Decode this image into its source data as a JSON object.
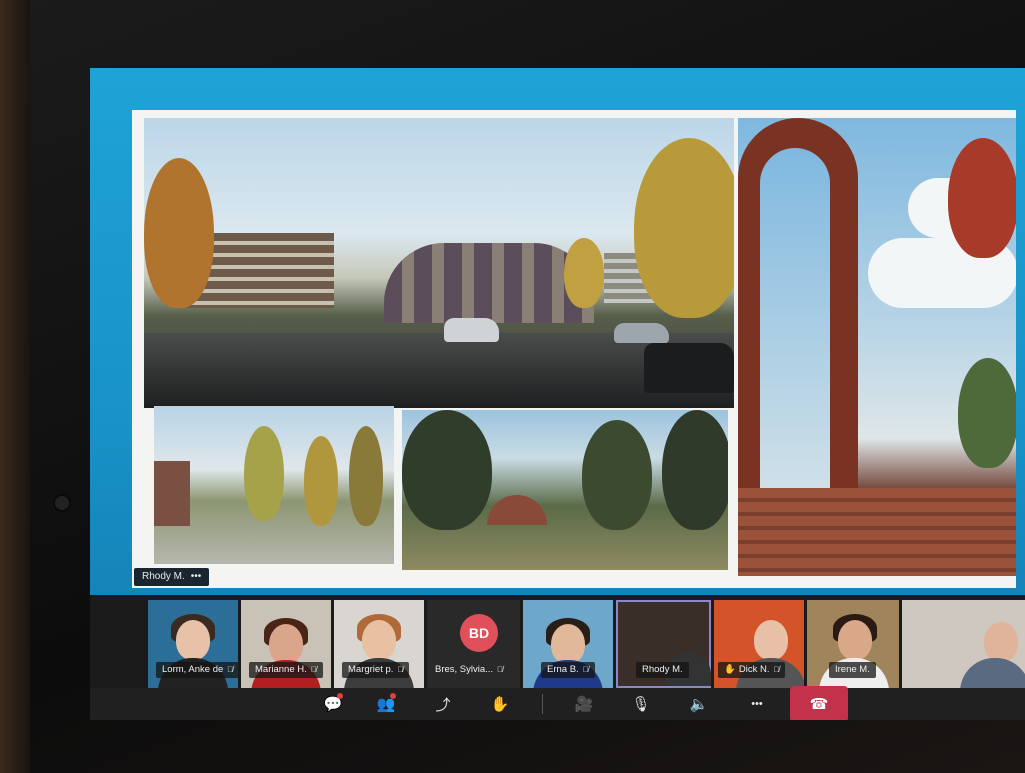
{
  "presenter": {
    "name": "Rhody M.",
    "more": "•••"
  },
  "participants": [
    {
      "name": "Lorm, Anke de",
      "muted": true,
      "bg": "#2b6f98",
      "skin": "#e8c2a8",
      "hair": "#3a2a20",
      "shirt": "#222"
    },
    {
      "name": "Marianne H.",
      "muted": true,
      "bg": "#c9c2b7",
      "skin": "#d9a68c",
      "hair": "#4a2416",
      "shirt": "#b02020"
    },
    {
      "name": "Margriet p.",
      "muted": true,
      "bg": "#d9d6d2",
      "skin": "#e8c0a2",
      "hair": "#b06a3a",
      "shirt": "#3c3c3c"
    },
    {
      "name": "Bres, Sylvia...",
      "muted": true,
      "avatar": "BD"
    },
    {
      "name": "Erna B.",
      "muted": true,
      "bg": "#6da7c9",
      "skin": "#e2b89a",
      "hair": "#2a1e18",
      "shirt": "#1e3a8a"
    },
    {
      "name": "Rhody M.",
      "muted": false,
      "bg": "#3a2e28",
      "skin": "#d8b09a",
      "hair": "#2a2a2a",
      "shirt": "#333"
    },
    {
      "name": "Dick N.",
      "muted": true,
      "raisedHand": true,
      "bg": "#d4542a",
      "skin": "#e8c0a8",
      "hair": "#ddd",
      "shirt": "#555"
    },
    {
      "name": "Irene M.",
      "muted": false,
      "bg": "#a0855c",
      "skin": "#d8a888",
      "hair": "#2a1a12",
      "shirt": "#eee"
    },
    {
      "name": "",
      "muted": false,
      "bg": "#cfc8c0",
      "skin": "#e0b49a",
      "hair": "#aaa",
      "shirt": "#5a6a80"
    }
  ],
  "controls": {
    "chat_icon": "💬",
    "people_icon": "👥",
    "share_icon": "⤴",
    "raise_hand_icon": "✋",
    "camera_icon": "🎥",
    "mic_icon": "🎙",
    "speaker_icon": "🔈",
    "more_icon": "•••",
    "hangup_icon": "☎"
  },
  "colors": {
    "share_bg": "#1891c6",
    "hangup": "#c4314b",
    "active_border": "#8c87c8",
    "avatar_bd": "#e0505a"
  }
}
